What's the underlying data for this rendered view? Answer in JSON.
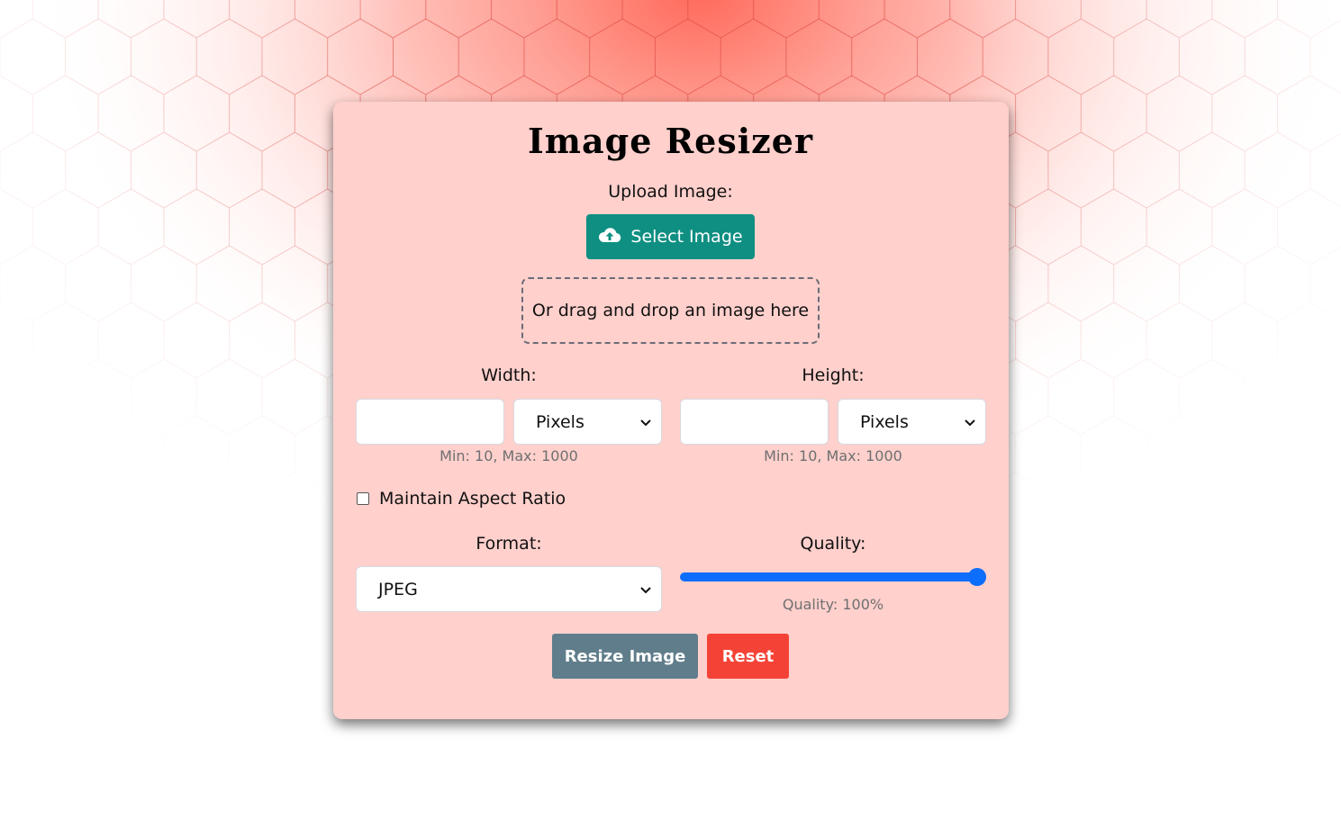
{
  "app": {
    "title": "Image Resizer"
  },
  "upload": {
    "label": "Upload Image:",
    "select_button": "Select Image",
    "select_icon": "cloud-upload-icon",
    "dropzone_text": "Or drag and drop an image here"
  },
  "width": {
    "label": "Width:",
    "value": "",
    "unit": "Pixels",
    "hint": "Min: 10, Max: 1000"
  },
  "height": {
    "label": "Height:",
    "value": "",
    "unit": "Pixels",
    "hint": "Min: 10, Max: 1000"
  },
  "aspect": {
    "label": "Maintain Aspect Ratio",
    "checked": false
  },
  "format": {
    "label": "Format:",
    "value": "JPEG"
  },
  "quality": {
    "label": "Quality:",
    "value_percent": 100,
    "readout": "Quality: 100%"
  },
  "actions": {
    "resize": "Resize Image",
    "reset": "Reset"
  },
  "colors": {
    "card_bg": "#ffd0cc",
    "primary_teal": "#0f8f82",
    "resize_gray": "#607d8b",
    "reset_red": "#f44336",
    "slider_blue": "#0d6efd",
    "background_accent": "#ff6a5a"
  }
}
